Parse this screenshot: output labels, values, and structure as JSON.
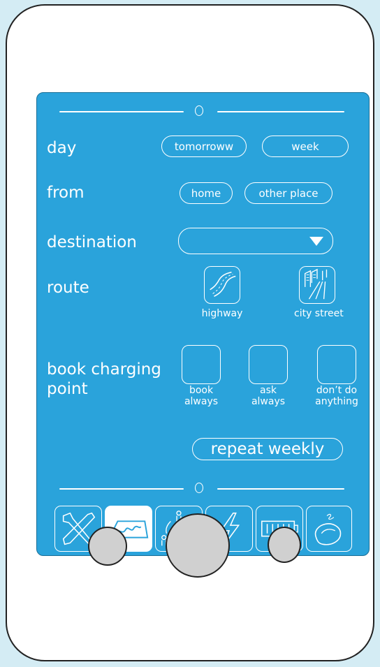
{
  "form": {
    "day": {
      "label": "day",
      "options": [
        "tomorroww",
        "week"
      ]
    },
    "from": {
      "label": "from",
      "options": [
        "home",
        "other place"
      ]
    },
    "destination": {
      "label": "destination",
      "value": ""
    },
    "route": {
      "label": "route",
      "options": [
        {
          "caption": "highway",
          "icon": "highway-icon"
        },
        {
          "caption": "city street",
          "icon": "city-street-icon"
        }
      ]
    },
    "booking": {
      "label": "book charging point",
      "options": [
        {
          "caption": "book always"
        },
        {
          "caption": "ask always"
        },
        {
          "caption": "don’t do anything"
        }
      ]
    },
    "repeat_label": "repeat weekly"
  },
  "tabs": [
    {
      "icon": "tools-icon",
      "active": false
    },
    {
      "icon": "route-planner-icon",
      "active": true
    },
    {
      "icon": "share-cycle-icon",
      "active": false
    },
    {
      "icon": "lightning-icon",
      "active": false
    },
    {
      "icon": "battery-icon",
      "active": false
    },
    {
      "icon": "car-crash-icon",
      "active": false
    }
  ],
  "colors": {
    "screen": "#2aa3db",
    "device": "#ffffff",
    "background": "#d4ecf4",
    "button": "#d0d0d0"
  }
}
